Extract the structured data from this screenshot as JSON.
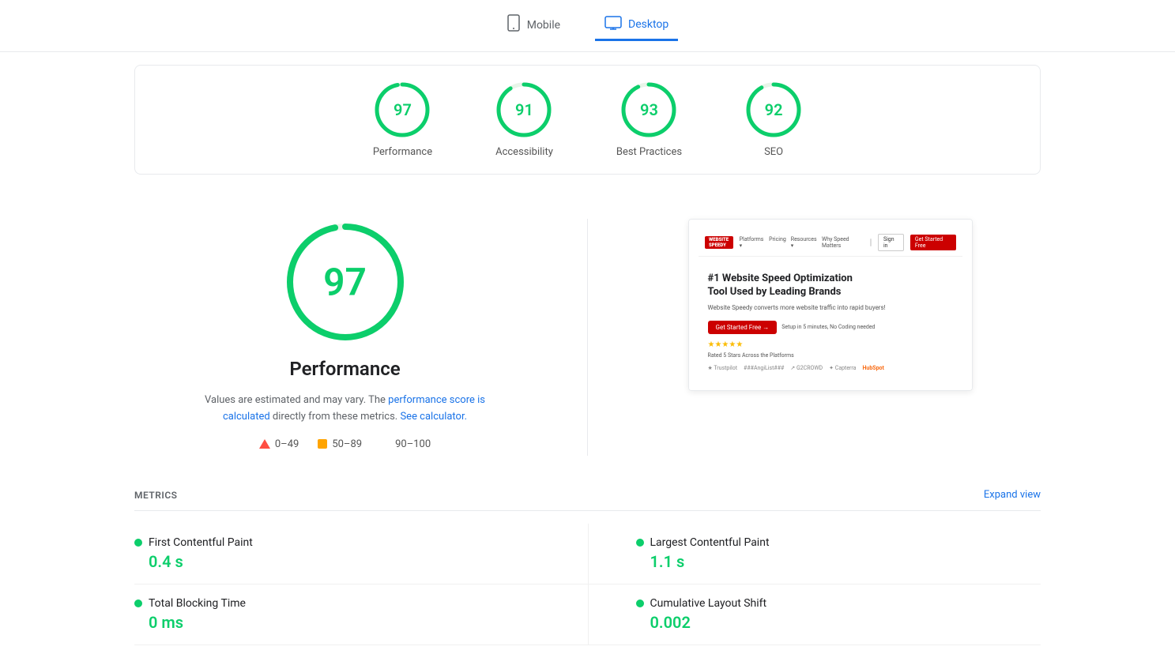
{
  "topBar": {
    "mobilTab": "Mobile",
    "desktopTab": "Desktop"
  },
  "scoreCards": [
    {
      "id": "performance",
      "score": 97,
      "label": "Performance",
      "circumference": 201.06,
      "dashOffset": 6.03
    },
    {
      "id": "accessibility",
      "score": 91,
      "label": "Accessibility",
      "circumference": 201.06,
      "dashOffset": 18.1
    },
    {
      "id": "best-practices",
      "score": 93,
      "label": "Best Practices",
      "circumference": 201.06,
      "dashOffset": 14.07
    },
    {
      "id": "seo",
      "score": 92,
      "label": "SEO",
      "circumference": 201.06,
      "dashOffset": 16.08
    }
  ],
  "mainScore": {
    "value": 97,
    "title": "Performance",
    "description": "Values are estimated and may vary. The ",
    "linkText": "performance score is calculated",
    "descriptionEnd": " directly from these metrics. ",
    "calcLink": "See calculator."
  },
  "legend": [
    {
      "type": "triangle",
      "range": "0–49",
      "color": "#ff4e42"
    },
    {
      "type": "square",
      "range": "50–89",
      "color": "#ffa400"
    },
    {
      "type": "circle",
      "range": "90–100",
      "color": "#0cce6b"
    }
  ],
  "screenshot": {
    "headline": "#1 Website Speed Optimization\nTool Used by Leading Brands",
    "sub": "Website Speedy converts more website traffic into rapid buyers!",
    "btnText": "Get Started Free",
    "setup": "Setup in 5 minutes, No Coding needed",
    "stars": "★★★★★",
    "starsLabel": "Rated 5 Stars Across the Platforms",
    "logoBrands": "Trustpilot   ###Angi/Angi###   G2CROWD   Capterra   HubSpot"
  },
  "metrics": {
    "title": "METRICS",
    "expandLabel": "Expand view",
    "items": [
      {
        "label": "First Contentful Paint",
        "value": "0.4 s"
      },
      {
        "label": "Largest Contentful Paint",
        "value": "1.1 s"
      },
      {
        "label": "Total Blocking Time",
        "value": "0 ms"
      },
      {
        "label": "Cumulative Layout Shift",
        "value": "0.002"
      }
    ]
  }
}
